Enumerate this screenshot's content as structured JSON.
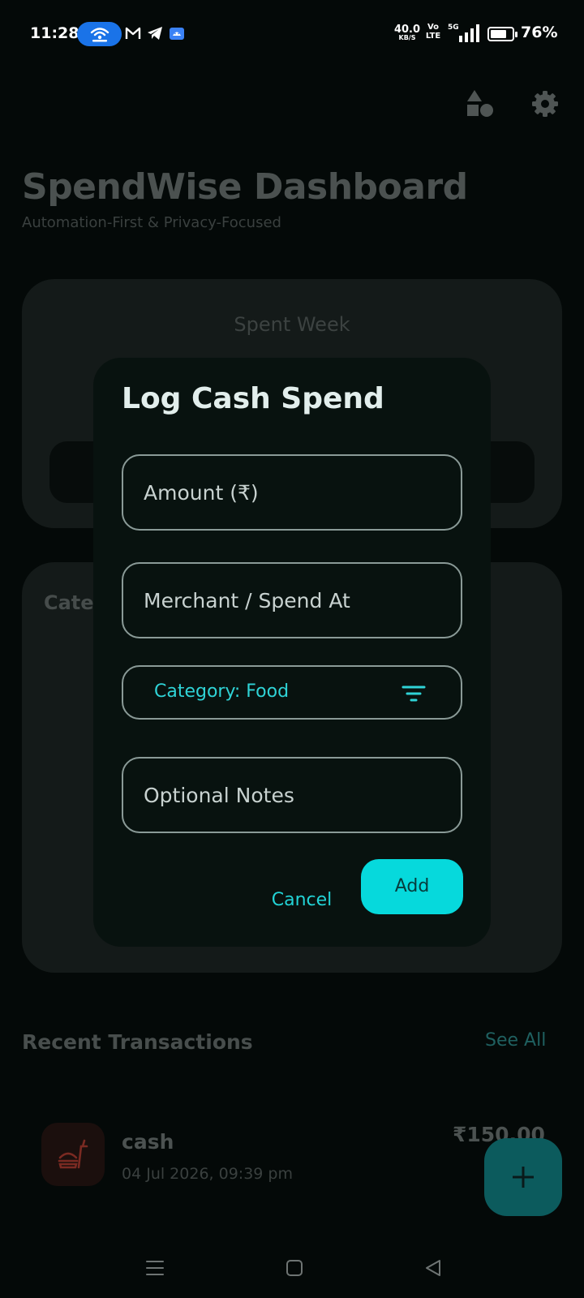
{
  "status_bar": {
    "time": "11:28",
    "net_speed_value": "40.0",
    "net_speed_unit": "KB/S",
    "volte_top": "Vo",
    "volte_bottom": "LTE",
    "network_type": "5G",
    "battery_percent": "76%",
    "battery_level": 0.76,
    "hotspot_icon": "hotspot-icon",
    "notification_icons": [
      "gmail-icon",
      "telegram-icon",
      "android-icon"
    ]
  },
  "header": {
    "shapes_icon": "shapes-icon",
    "settings_icon": "gear-icon"
  },
  "dashboard": {
    "title": "SpendWise Dashboard",
    "subtitle": "Automation-First & Privacy-Focused",
    "spent_card_label": "Spent Week",
    "category_card_label": "Cate"
  },
  "recent": {
    "title": "Recent Transactions",
    "see_all": "See All",
    "transactions": [
      {
        "name": "cash",
        "date": "04 Jul 2026, 09:39 pm",
        "amount": "₹150.00",
        "icon": "fastfood-icon"
      }
    ]
  },
  "dialog": {
    "title": "Log Cash Spend",
    "amount_placeholder": "Amount (₹)",
    "merchant_placeholder": "Merchant / Spend At",
    "category_label": "Category: Food",
    "notes_placeholder": "Optional Notes",
    "cancel_label": "Cancel",
    "add_label": "Add"
  },
  "colors": {
    "accent": "#06d9dc",
    "background": "#040908",
    "dialog_bg": "#08120f"
  }
}
